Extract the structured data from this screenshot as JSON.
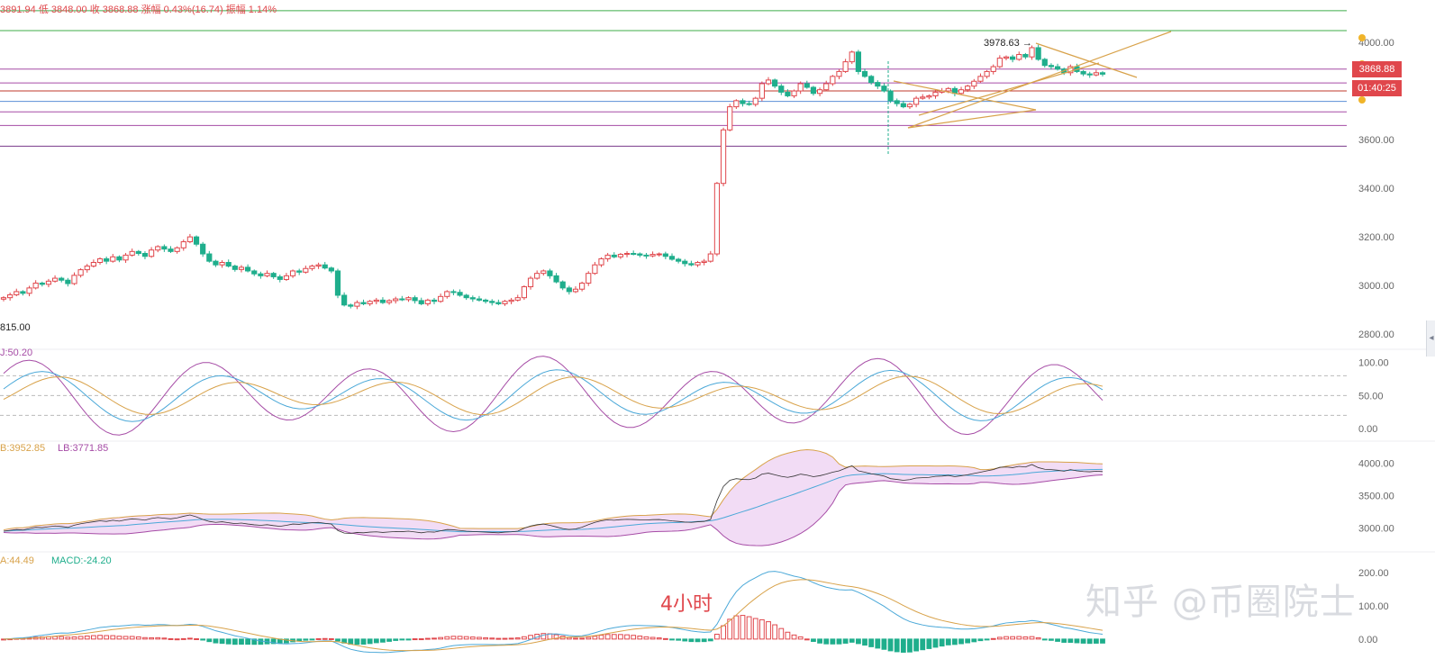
{
  "header": {
    "ohlc_text": "3891.94 低 3848.00 收 3868.88 涨幅 0.43%(16.74) 振幅 1.14%"
  },
  "main_axis": {
    "min": 2760,
    "max": 4100,
    "ticks": [
      "4000.00",
      "3800.00",
      "3600.00",
      "3400.00",
      "3200.00",
      "3000.00",
      "2800.00"
    ]
  },
  "annotations": {
    "peak_label": "3978.63 →",
    "low_label": "815.00",
    "price_tag": "3868.88",
    "countdown_tag": "01:40:25",
    "timeframe": "4小时",
    "watermark": "知乎 @币圈院士"
  },
  "horizontal_levels": [
    {
      "value": 4130,
      "color": "#3fae4a"
    },
    {
      "value": 4048,
      "color": "#3fae4a"
    },
    {
      "value": 3890,
      "color": "#a64ca6"
    },
    {
      "value": 3833,
      "color": "#a64ca6"
    },
    {
      "value": 3800,
      "color": "#c0392b"
    },
    {
      "value": 3757,
      "color": "#5b8fd6"
    },
    {
      "value": 3714,
      "color": "#a64ca6"
    },
    {
      "value": 3658,
      "color": "#a64ca6"
    },
    {
      "value": 3573,
      "color": "#7a3a8a"
    }
  ],
  "colors": {
    "up": "#e0474c",
    "down": "#1fae8c",
    "accent": "#e0474c",
    "trend": "#d8a24a"
  },
  "kdj": {
    "label": "J:50.20",
    "ticks": [
      "100.00",
      "50.00",
      "0.00"
    ]
  },
  "boll": {
    "label": "LB:3952.85  LB:3771.85",
    "label_a": "B:3952.85",
    "label_b": "LB:3771.85",
    "ticks": [
      "4000.00",
      "3500.00",
      "3000.00"
    ]
  },
  "macd": {
    "label_a": "A:44.49",
    "label_b": "MACD:-24.20",
    "ticks": [
      "200.00",
      "100.00",
      "0.00"
    ]
  },
  "chart_data": {
    "type": "candlestick",
    "close_series": [
      2950,
      2962,
      2975,
      2968,
      2990,
      3010,
      3005,
      3018,
      3030,
      3022,
      3008,
      3042,
      3065,
      3080,
      3095,
      3110,
      3100,
      3118,
      3105,
      3125,
      3140,
      3132,
      3120,
      3146,
      3160,
      3150,
      3140,
      3155,
      3180,
      3200,
      3170,
      3130,
      3100,
      3085,
      3095,
      3080,
      3066,
      3075,
      3060,
      3048,
      3040,
      3050,
      3036,
      3025,
      3040,
      3060,
      3055,
      3070,
      3080,
      3085,
      3072,
      3060,
      2960,
      2920,
      2915,
      2930,
      2925,
      2935,
      2940,
      2930,
      2938,
      2945,
      2942,
      2950,
      2938,
      2925,
      2940,
      2935,
      2955,
      2975,
      2972,
      2960,
      2950,
      2945,
      2940,
      2935,
      2930,
      2925,
      2935,
      2940,
      2950,
      2995,
      3030,
      3050,
      3060,
      3040,
      3015,
      2990,
      2975,
      2985,
      3010,
      3050,
      3085,
      3110,
      3125,
      3118,
      3128,
      3132,
      3130,
      3125,
      3122,
      3128,
      3130,
      3120,
      3108,
      3100,
      3090,
      3085,
      3095,
      3100,
      3130,
      3420,
      3640,
      3735,
      3760,
      3748,
      3745,
      3770,
      3830,
      3845,
      3820,
      3795,
      3780,
      3800,
      3830,
      3815,
      3790,
      3805,
      3830,
      3860,
      3880,
      3920,
      3960,
      3880,
      3860,
      3835,
      3820,
      3800,
      3760,
      3748,
      3735,
      3745,
      3770,
      3775,
      3780,
      3795,
      3800,
      3810,
      3790,
      3805,
      3820,
      3840,
      3860,
      3880,
      3900,
      3935,
      3940,
      3930,
      3950,
      3940,
      3978,
      3930,
      3905,
      3900,
      3890,
      3875,
      3900,
      3880,
      3870,
      3866,
      3875,
      3869
    ]
  }
}
